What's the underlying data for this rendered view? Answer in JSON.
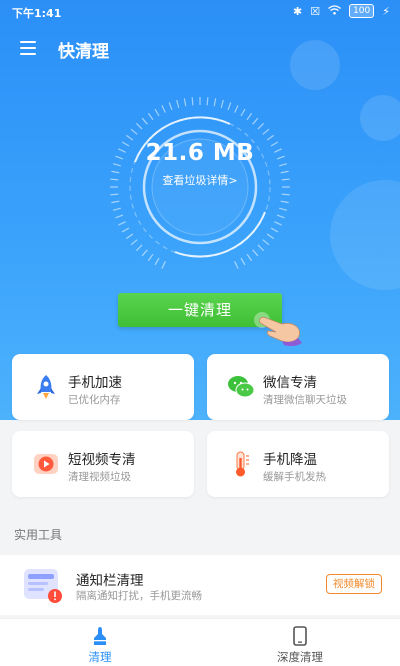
{
  "status_bar": {
    "time": "下午1:41",
    "battery": "100"
  },
  "header": {
    "title": "快清理"
  },
  "gauge": {
    "size": "21.6 MB",
    "detail_link": "查看垃圾详情>"
  },
  "actions": {
    "one_click_clean": "一键清理"
  },
  "cards": [
    {
      "title": "手机加速",
      "subtitle": "已优化内存",
      "icon": "rocket-icon"
    },
    {
      "title": "微信专清",
      "subtitle": "清理微信聊天垃圾",
      "icon": "wechat-icon"
    },
    {
      "title": "短视频专清",
      "subtitle": "清理视频垃圾",
      "icon": "video-play-icon"
    },
    {
      "title": "手机降温",
      "subtitle": "缓解手机发热",
      "icon": "thermometer-icon"
    }
  ],
  "tools": {
    "section_label": "实用工具",
    "items": [
      {
        "title": "通知栏清理",
        "subtitle": "隔离通知打扰，手机更流畅",
        "badge": "视频解锁",
        "icon": "notification-icon"
      }
    ]
  },
  "tabbar": {
    "tabs": [
      {
        "label": "清理",
        "icon": "broom-icon",
        "active": true
      },
      {
        "label": "深度清理",
        "icon": "phone-icon",
        "active": false
      }
    ]
  },
  "colors": {
    "primary": "#2b8ff7",
    "button_green": "#45c23b",
    "badge_orange": "#f08a2c",
    "background": "#f3f4f6"
  }
}
